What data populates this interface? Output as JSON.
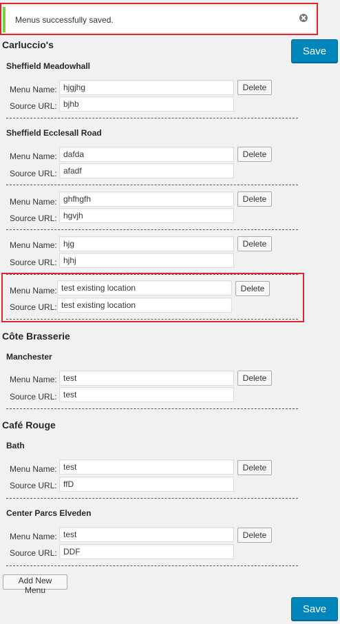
{
  "notice": {
    "text": "Menus successfully saved.",
    "dismiss_icon": "close-circle-icon"
  },
  "save_label": "Save",
  "delete_label": "Delete",
  "labels": {
    "menu_name": "Menu Name:",
    "source_url": "Source URL:"
  },
  "brands": [
    {
      "name": "Carluccio's",
      "locations": [
        {
          "name": "Sheffield Meadowhall",
          "menus": [
            {
              "menu_name": "hjgjhg",
              "source_url": "bjhb"
            }
          ]
        },
        {
          "name": "Sheffield Ecclesall Road",
          "menus": [
            {
              "menu_name": "dafda",
              "source_url": "afadf"
            },
            {
              "menu_name": "ghfhgfh",
              "source_url": "hgvjh"
            },
            {
              "menu_name": "hjg",
              "source_url": "hjhj"
            },
            {
              "menu_name": "test existing location",
              "source_url": "test existing location"
            }
          ]
        }
      ]
    },
    {
      "name": "Côte Brasserie",
      "locations": [
        {
          "name": "Manchester",
          "menus": [
            {
              "menu_name": "test",
              "source_url": "test"
            }
          ]
        }
      ]
    },
    {
      "name": "Café Rouge",
      "locations": [
        {
          "name": "Bath",
          "menus": [
            {
              "menu_name": "test",
              "source_url": "ffD"
            }
          ]
        },
        {
          "name": "Center Parcs Elveden",
          "menus": [
            {
              "menu_name": "test",
              "source_url": "DDF"
            }
          ]
        }
      ]
    }
  ],
  "add_new_menu_label": "Add New Menu",
  "colors": {
    "primary": "#0085ba",
    "notice_accent": "#7ad03a",
    "highlight": "#e0242c"
  }
}
